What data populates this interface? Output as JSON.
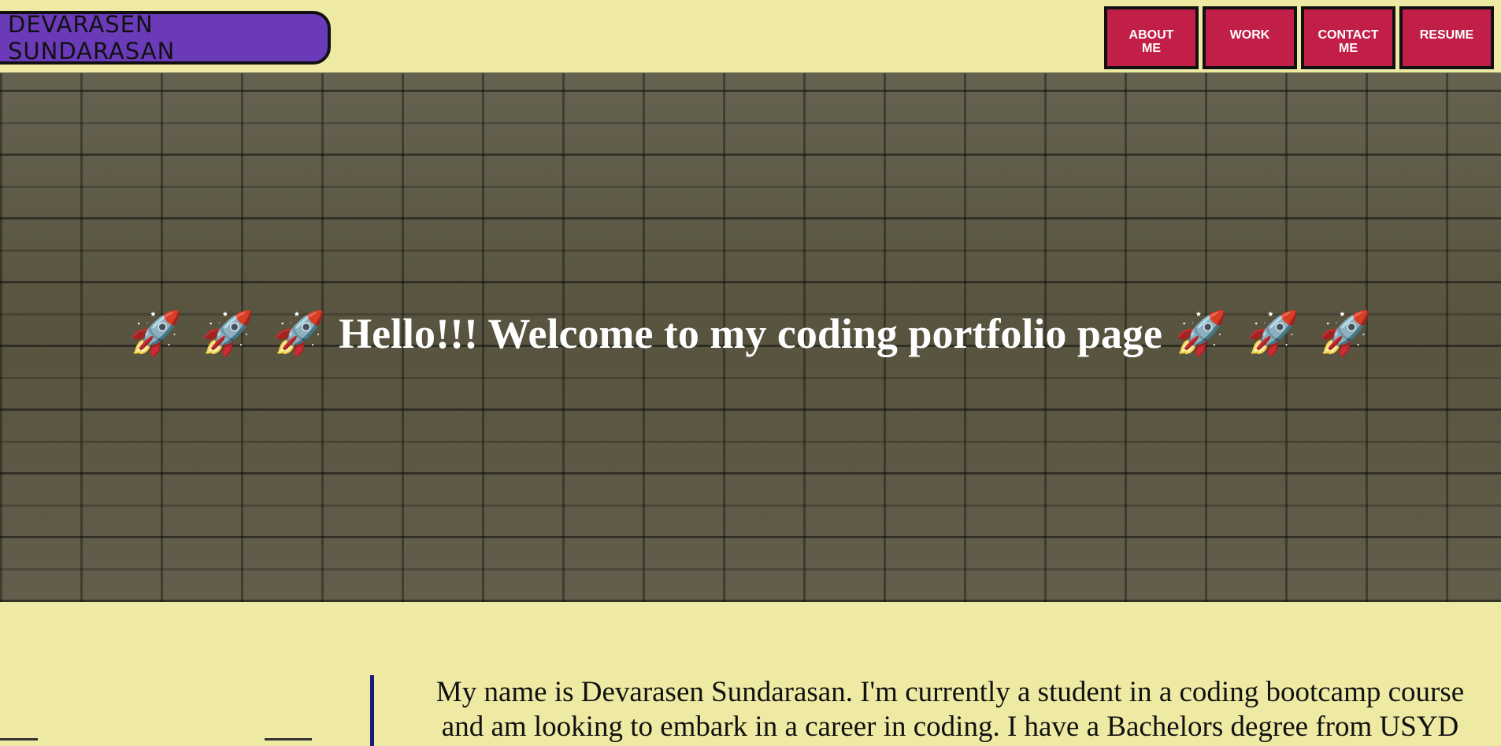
{
  "header": {
    "brand": "DEVARASEN SUNDARASAN",
    "nav": [
      {
        "label": "ABOUT\nME"
      },
      {
        "label": "WORK"
      },
      {
        "label": "CONTACT\nME"
      },
      {
        "label": "RESUME"
      }
    ]
  },
  "hero": {
    "title": "Hello!!! Welcome to my coding portfolio page",
    "rocket": "🚀"
  },
  "about": {
    "text": "My name is Devarasen Sundarasan. I'm currently a student in a coding bootcamp course and am looking to embark in a career in coding. I have a Bachelors degree from USYD"
  },
  "colors": {
    "background": "#eeeaa3",
    "brand_bg": "#6a3ab8",
    "nav_bg": "#c11f48"
  }
}
